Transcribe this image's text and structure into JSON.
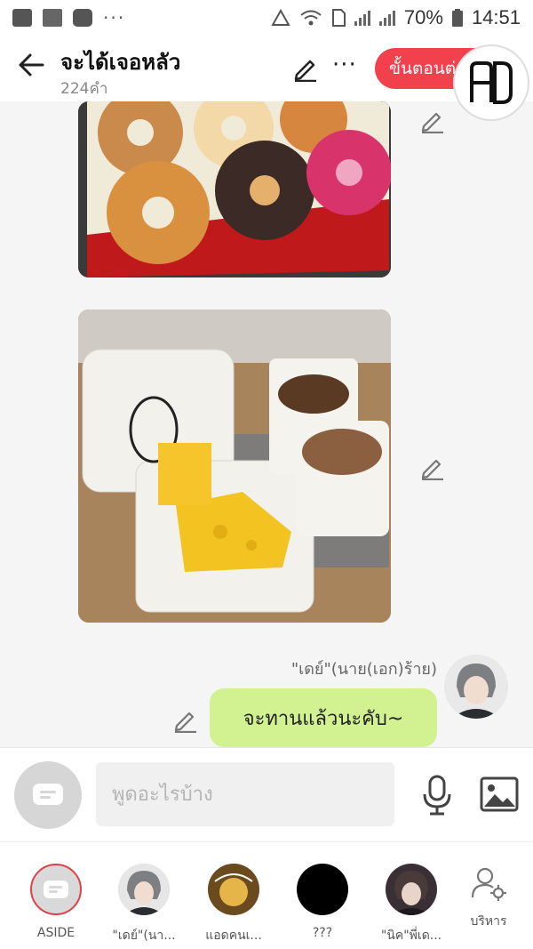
{
  "statusbar": {
    "dots": "···",
    "battery": "70%",
    "time": "14:51"
  },
  "header": {
    "title": "จะได้เจอหลัว",
    "subtitle": "224คำ",
    "next_button": "ขั้นตอนต่อไป",
    "logo_text": "AD",
    "accent_color": "#f1414c"
  },
  "messages": {
    "sender_name": "\"เดย์\"(นาย(เอก)ร้าย)",
    "bubble_text": "จะทานแล้วนะคับ~",
    "bubble_color": "#d2f191"
  },
  "input": {
    "placeholder": "พูดอะไรบ้าง"
  },
  "bottom_nav": {
    "items": [
      {
        "label": "ASIDE",
        "icon": "chat-icon"
      },
      {
        "label": "\"เดย์\"(นา...",
        "icon": "avatar"
      },
      {
        "label": "แอดคนเ...",
        "icon": "avatar"
      },
      {
        "label": "???",
        "icon": "avatar"
      },
      {
        "label": "\"นิค\"พี่เด...",
        "icon": "avatar"
      },
      {
        "label": "บริหาร",
        "icon": "manage-icon"
      }
    ]
  }
}
